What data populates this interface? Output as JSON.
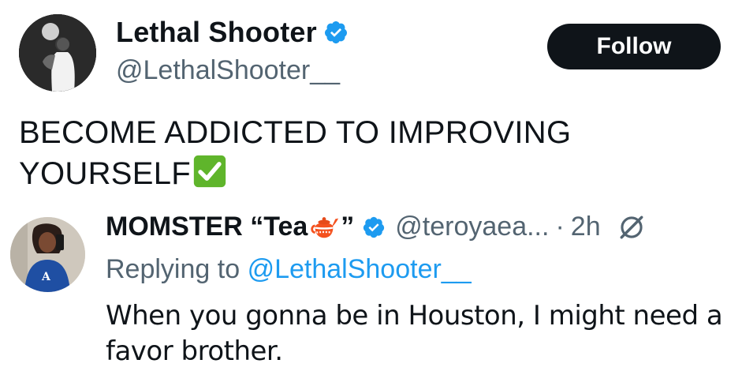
{
  "tweet": {
    "author": {
      "name": "Lethal Shooter",
      "handle": "@LethalShooter__",
      "verified": true,
      "avatar_icon": "avatar-photo"
    },
    "follow_label": "Follow",
    "text_lines": [
      "BECOME ADDICTED TO IMPROVING",
      "YOURSELF"
    ],
    "emoji": "check-mark-button-icon"
  },
  "reply": {
    "author": {
      "name_prefix": "MOMSTER “Tea",
      "name_suffix": "”",
      "handle": "@teroyaea...",
      "verified": true,
      "avatar_icon": "avatar-photo"
    },
    "separator": "·",
    "time": "2h",
    "replying_to_prefix": "Replying to",
    "replying_to_handle": "@LethalShooter__",
    "text_lines": [
      "When you gonna be in Houston, I might need a",
      "favor brother."
    ]
  },
  "colors": {
    "text": "#0f1419",
    "secondary": "#536471",
    "link": "#1d9bf0",
    "verified_badge": "#1d9bf0",
    "follow_bg": "#0f1419"
  }
}
